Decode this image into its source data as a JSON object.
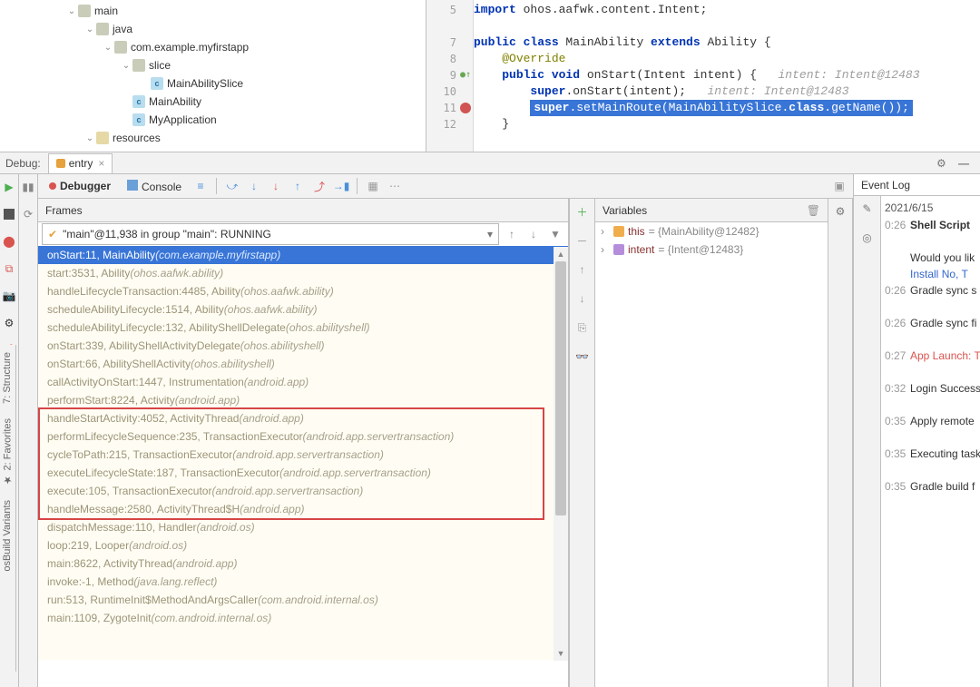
{
  "tree": {
    "main": "main",
    "java": "java",
    "pkg": "com.example.myfirstapp",
    "slice": "slice",
    "mainAbilitySlice": "MainAbilitySlice",
    "mainAbility": "MainAbility",
    "myApplication": "MyApplication",
    "resources": "resources"
  },
  "code": {
    "l5a": "import",
    "l5b": " ohos.aafwk.content.Intent;",
    "l7a": "public class",
    "l7b": " MainAbility ",
    "l7c": "extends",
    "l7d": " Ability {",
    "l8": "@Override",
    "l9a": "public void",
    "l9b": " onStart(Intent intent) {   ",
    "l9c": "intent: Intent@12483",
    "l10a": "super",
    "l10b": ".onStart(intent);   ",
    "l10c": "intent: Intent@12483",
    "l11a": "super",
    "l11b": ".setMainRoute(MainAbilitySlice.",
    "l11c": "class",
    "l11d": ".getName());",
    "l12": "}",
    "ln5": "5",
    "ln7": "7",
    "ln8": "8",
    "ln9": "9",
    "ln10": "10",
    "ln11": "11",
    "ln12": "12"
  },
  "debug": {
    "label": "Debug:",
    "tabName": "entry"
  },
  "debugger": {
    "tab1": "Debugger",
    "tab2": "Console"
  },
  "frames": {
    "header": "Frames",
    "thread": "\"main\"@11,938 in group \"main\": RUNNING",
    "rows": [
      {
        "m": "onStart:11, MainAbility ",
        "p": "(com.example.myfirstapp)",
        "sel": true,
        "box": false
      },
      {
        "m": "start:3531, Ability ",
        "p": "(ohos.aafwk.ability)",
        "sel": false,
        "box": false
      },
      {
        "m": "handleLifecycleTransaction:4485, Ability ",
        "p": "(ohos.aafwk.ability)",
        "sel": false,
        "box": false
      },
      {
        "m": "scheduleAbilityLifecycle:1514, Ability ",
        "p": "(ohos.aafwk.ability)",
        "sel": false,
        "box": false
      },
      {
        "m": "scheduleAbilityLifecycle:132, AbilityShellDelegate ",
        "p": "(ohos.abilityshell)",
        "sel": false,
        "box": false
      },
      {
        "m": "onStart:339, AbilityShellActivityDelegate ",
        "p": "(ohos.abilityshell)",
        "sel": false,
        "box": false
      },
      {
        "m": "onStart:66, AbilityShellActivity ",
        "p": "(ohos.abilityshell)",
        "sel": false,
        "box": false
      },
      {
        "m": "callActivityOnStart:1447, Instrumentation ",
        "p": "(android.app)",
        "sel": false,
        "box": false
      },
      {
        "m": "performStart:8224, Activity ",
        "p": "(android.app)",
        "sel": false,
        "box": false
      },
      {
        "m": "handleStartActivity:4052, ActivityThread ",
        "p": "(android.app)",
        "sel": false,
        "box": true
      },
      {
        "m": "performLifecycleSequence:235, TransactionExecutor ",
        "p": "(android.app.servertransaction)",
        "sel": false,
        "box": true
      },
      {
        "m": "cycleToPath:215, TransactionExecutor ",
        "p": "(android.app.servertransaction)",
        "sel": false,
        "box": true
      },
      {
        "m": "executeLifecycleState:187, TransactionExecutor ",
        "p": "(android.app.servertransaction)",
        "sel": false,
        "box": true
      },
      {
        "m": "execute:105, TransactionExecutor ",
        "p": "(android.app.servertransaction)",
        "sel": false,
        "box": true
      },
      {
        "m": "handleMessage:2580, ActivityThread$H ",
        "p": "(android.app)",
        "sel": false,
        "box": true
      },
      {
        "m": "dispatchMessage:110, Handler ",
        "p": "(android.os)",
        "sel": false,
        "box": false
      },
      {
        "m": "loop:219, Looper ",
        "p": "(android.os)",
        "sel": false,
        "box": false
      },
      {
        "m": "main:8622, ActivityThread ",
        "p": "(android.app)",
        "sel": false,
        "box": false
      },
      {
        "m": "invoke:-1, Method ",
        "p": "(java.lang.reflect)",
        "sel": false,
        "box": false
      },
      {
        "m": "run:513, RuntimeInit$MethodAndArgsCaller ",
        "p": "(com.android.internal.os)",
        "sel": false,
        "box": false
      },
      {
        "m": "main:1109, ZygoteInit ",
        "p": "(com.android.internal.os)",
        "sel": false,
        "box": false
      }
    ]
  },
  "vars": {
    "header": "Variables",
    "this_n": "this",
    "this_v": " = {MainAbility@12482}",
    "intent_n": "intent",
    "intent_v": " = {Intent@12483}"
  },
  "eventlog": {
    "header": "Event Log",
    "date": "2021/6/15",
    "rows": [
      {
        "t": "0:26",
        "bold": "Shell Script",
        "txt": "",
        "cls": ""
      },
      {
        "t": "",
        "txt": "Would you lik",
        "cls": ""
      },
      {
        "t": "",
        "txt": "",
        "links": [
          "Install",
          "No, T"
        ]
      },
      {
        "t": "0:26",
        "txt": "Gradle sync s",
        "cls": ""
      },
      {
        "t": "0:26",
        "txt": "Gradle sync fi",
        "cls": ""
      },
      {
        "t": "0:27",
        "txt": "App Launch: T",
        "cls": "red"
      },
      {
        "t": "0:32",
        "txt": "Login Success",
        "cls": ""
      },
      {
        "t": "0:35",
        "txt": "Apply remote",
        "cls": ""
      },
      {
        "t": "0:35",
        "txt": "Executing task",
        "cls": ""
      },
      {
        "t": "0:35",
        "txt": "Gradle build f",
        "cls": ""
      }
    ]
  },
  "vtabs": {
    "structure": "7: Structure",
    "favorites": "2: Favorites",
    "build": "osBuild Variants"
  }
}
